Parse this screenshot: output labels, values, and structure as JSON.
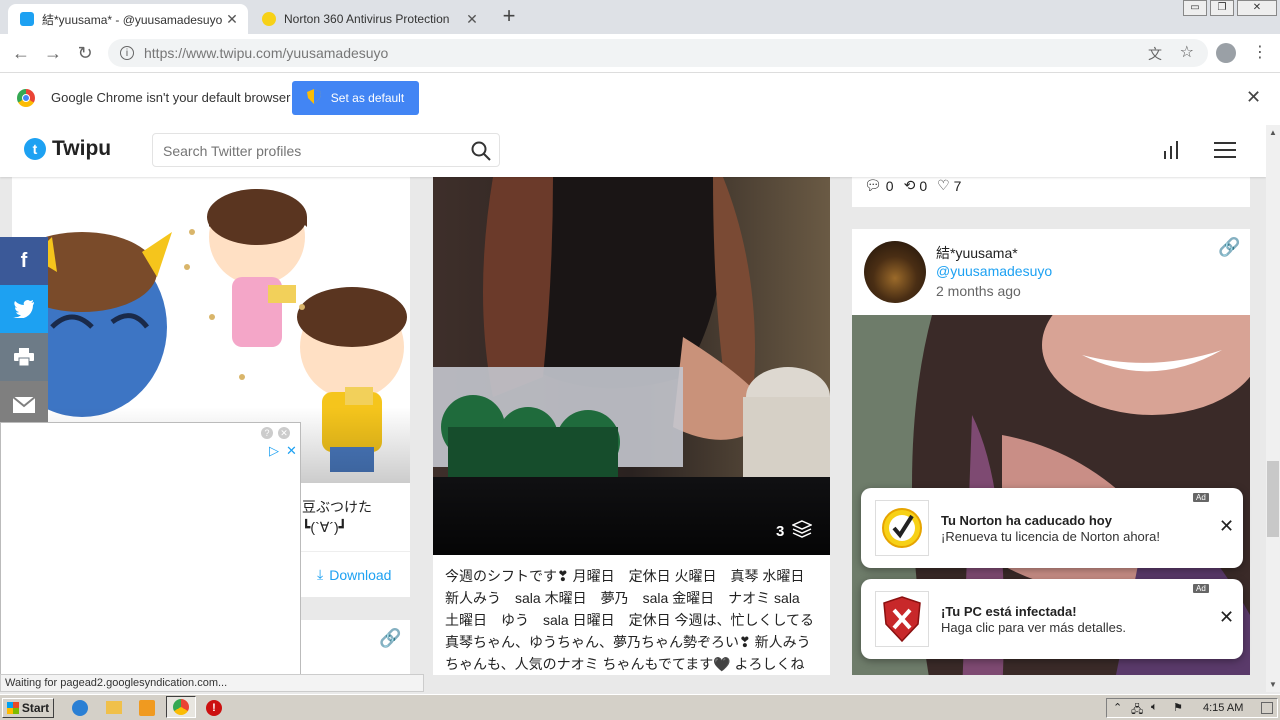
{
  "browser": {
    "tabs": [
      {
        "title": "結*yuusama* - @yuusamadesuyo Tw",
        "active": true
      },
      {
        "title": "Norton 360 Antivirus Protection",
        "active": false
      }
    ],
    "new_tab": "+",
    "url_host": "https://www.twipu.com",
    "url_path": "/yuusamadesuyo",
    "window_controls": [
      "▭",
      "❐",
      "✕"
    ]
  },
  "infobar": {
    "message": "Google Chrome isn't your default browser",
    "button": "Set as default",
    "close": "✕"
  },
  "site": {
    "logo_text": "Twipu",
    "search_placeholder": "Search Twitter profiles"
  },
  "left_column": {
    "text_line1": "豆ぶつけた",
    "text_line2": "┗(`∀´)┛",
    "download_label": "Download"
  },
  "middle_post": {
    "media_count": "3",
    "text": "今週のシフトです❣ 月曜日　定休日 火曜日　真琴 水曜日　新人みう　sala 木曜日　夢乃　sala 金曜日　ナオミ sala 土曜日　ゆう　sala 日曜日　定休日 今週は、忙しくしてる真琴ちゃん、ゆうちゃん、夢乃ちゃん勢ぞろい❣ 新人みうちゃんも、人気のナオミ ちゃんもでてます🖤 よろしくね"
  },
  "right_column": {
    "stats": {
      "replies": "0",
      "retweets": "0",
      "likes": "7"
    },
    "profile": {
      "name": "結*yuusama*",
      "handle": "@yuusamadesuyo",
      "time": "2 months ago"
    }
  },
  "notifications": [
    {
      "title": "Tu Norton ha caducado hoy",
      "body": "¡Renueva tu licencia de Norton ahora!",
      "ad": "Ad"
    },
    {
      "title": "¡Tu PC está infectada!",
      "body": "Haga clic para ver más detalles.",
      "ad": "Ad"
    }
  ],
  "status_text": "Waiting for pagead2.googlesyndication.com...",
  "taskbar": {
    "start": "Start",
    "clock": "4:15 AM"
  },
  "colors": {
    "twitter_blue": "#1da1f2",
    "chrome_blue": "#4285f4",
    "facebook": "#3b5998",
    "print": "#6d7b87",
    "mail": "#7f7f7f"
  }
}
